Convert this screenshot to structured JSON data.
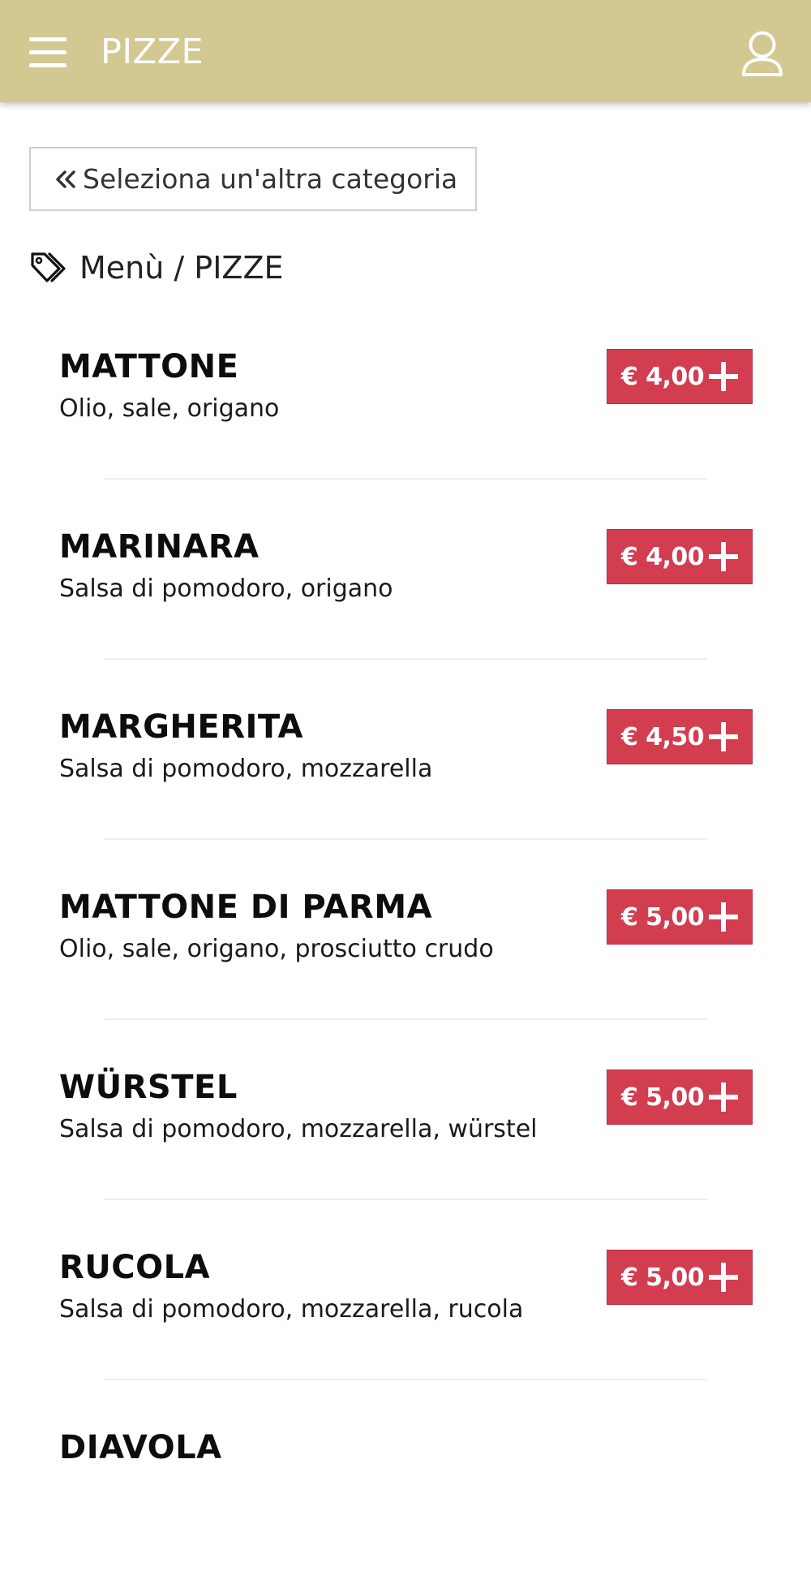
{
  "header": {
    "title": "PIZZE",
    "menu_icon": "hamburger-menu-icon",
    "user_icon": "user-icon",
    "bar_color": "#d3c792"
  },
  "back_button": {
    "label": "Seleziona un'altra categoria",
    "icon": "double-chevron-left-icon"
  },
  "breadcrumb": {
    "icon": "tags-icon",
    "text": "Menù / PIZZE"
  },
  "accent_color": "#d23d50",
  "items": [
    {
      "name": "MATTONE",
      "description": "Olio, sale, origano",
      "price": "€ 4,00"
    },
    {
      "name": "MARINARA",
      "description": "Salsa di pomodoro, origano",
      "price": "€ 4,00"
    },
    {
      "name": "MARGHERITA",
      "description": "Salsa di pomodoro, mozzarella",
      "price": "€ 4,50"
    },
    {
      "name": "MATTONE DI PARMA",
      "description": "Olio, sale, origano, prosciutto crudo",
      "price": "€ 5,00"
    },
    {
      "name": "WÜRSTEL",
      "description": "Salsa di pomodoro, mozzarella, würstel",
      "price": "€ 5,00"
    },
    {
      "name": "RUCOLA",
      "description": "Salsa di pomodoro, mozzarella, rucola",
      "price": "€ 5,00"
    },
    {
      "name": "DIAVOLA",
      "description": "",
      "price": ""
    }
  ]
}
